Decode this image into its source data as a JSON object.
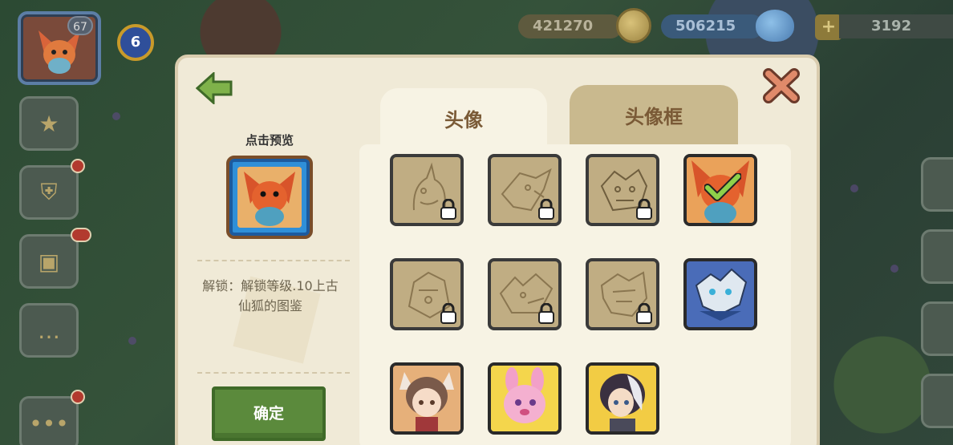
{
  "hud": {
    "player_level": "67",
    "badge_value": "6",
    "coins": "421270",
    "gems": "506215",
    "premium": "3192",
    "plus": "+"
  },
  "dialog": {
    "preview_label": "点击预览",
    "unlock_text": "解锁：解锁等级.10上古仙狐的图鉴",
    "confirm_label": "确定",
    "tabs": [
      {
        "label": "头像",
        "active": true
      },
      {
        "label": "头像框",
        "active": false
      }
    ],
    "avatars": [
      {
        "name": "unicorn",
        "state": "locked"
      },
      {
        "name": "eagle",
        "state": "locked"
      },
      {
        "name": "dragon",
        "state": "locked"
      },
      {
        "name": "fox-spirit",
        "state": "selected"
      },
      {
        "name": "armored-beast",
        "state": "locked"
      },
      {
        "name": "wolf-dragon",
        "state": "locked"
      },
      {
        "name": "bone-dragon",
        "state": "locked"
      },
      {
        "name": "ice-dragon",
        "state": "unlocked"
      },
      {
        "name": "cat-girl",
        "state": "unlocked"
      },
      {
        "name": "pink-bunny",
        "state": "unlocked"
      },
      {
        "name": "silver-hair-boy",
        "state": "unlocked"
      }
    ]
  },
  "colors": {
    "dialog_bg": "#f0ead7",
    "tab_active": "#f7f3e4",
    "tab_inactive": "#c9b98e",
    "confirm": "#5b8a3c",
    "locked_cell": "#c0ad83"
  }
}
